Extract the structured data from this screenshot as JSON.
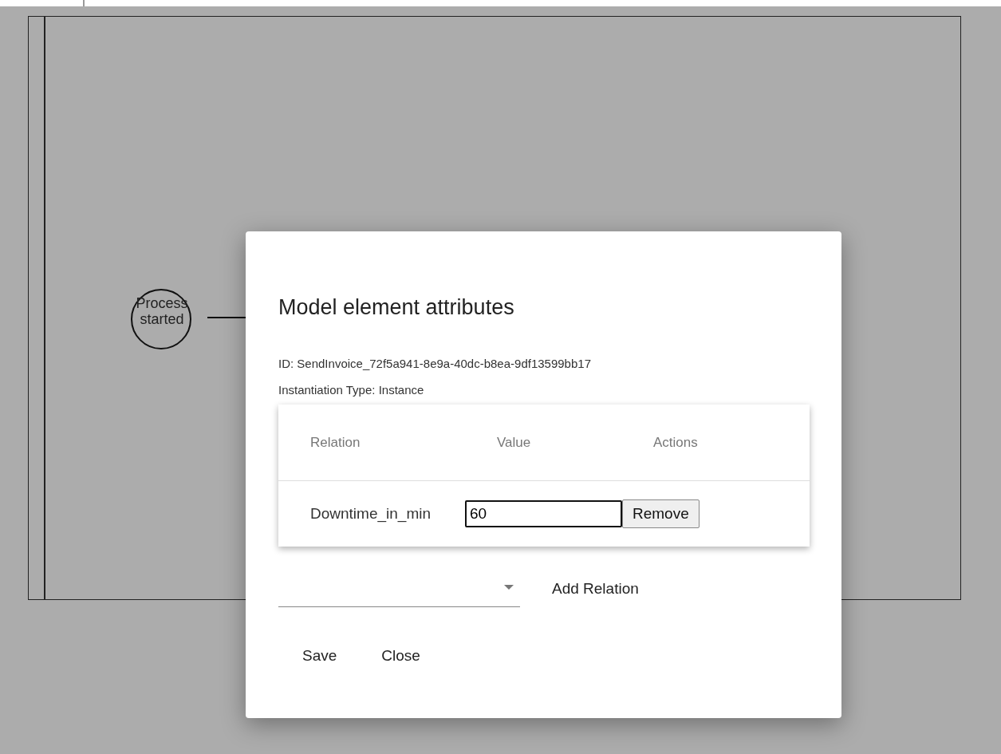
{
  "diagram": {
    "start_event": {
      "label": "Process started"
    }
  },
  "dialog": {
    "title": "Model element attributes",
    "id_line": "ID: SendInvoice_72f5a941-8e9a-40dc-b8ea-9df13599bb17",
    "type_line": "Instantiation Type: Instance",
    "table": {
      "columns": [
        "Relation",
        "Value",
        "Actions"
      ],
      "rows": [
        {
          "relation": "Downtime_in_min",
          "value": "60",
          "action": "Remove"
        }
      ]
    },
    "add_relation": {
      "button": "Add Relation"
    },
    "buttons": [
      "Save",
      "Close"
    ]
  }
}
